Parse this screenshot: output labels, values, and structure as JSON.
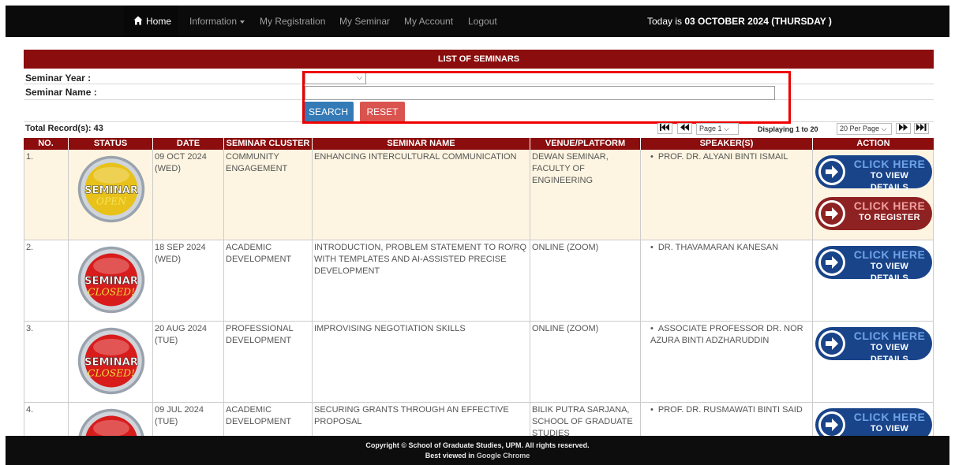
{
  "nav": {
    "home": "Home",
    "information": "Information",
    "my_registration": "My Registration",
    "my_seminar": "My Seminar",
    "my_account": "My Account",
    "logout": "Logout",
    "today_prefix": "Today is",
    "today_value": "03 OCTOBER 2024 (THURSDAY )"
  },
  "banner": "LIST OF SEMINARS",
  "filters": {
    "year_label": "Seminar Year :",
    "year_value": "",
    "name_label": "Seminar Name :",
    "name_value": "",
    "search": "SEARCH",
    "reset": "RESET"
  },
  "total_records": "Total Record(s): 43",
  "pager": {
    "first": "⏮",
    "prev": "◀◀",
    "page_select": "Page 1",
    "displaying": "Displaying 1 to 20",
    "per_page": "20 Per Page",
    "next": "▶▶",
    "last": "⏭"
  },
  "columns": [
    "NO.",
    "STATUS",
    "DATE",
    "SEMINAR CLUSTER",
    "SEMINAR NAME",
    "VENUE/PLATFORM",
    "SPEAKER(S)",
    "ACTION"
  ],
  "rows": [
    {
      "no": "1.",
      "status": "SEMINAR OPEN",
      "status_icon": "seminar-open-badge",
      "date": "09 OCT 2024 (WED)",
      "cluster": "COMMUNITY ENGAGEMENT",
      "name": "ENHANCING INTERCULTURAL COMMUNICATION",
      "venue": "DEWAN SEMINAR, FACULTY OF ENGINEERING",
      "speaker": "PROF. DR. ALYANI BINTI ISMAIL",
      "highlight": true,
      "actions": [
        {
          "line1": "CLICK HERE",
          "line2": "TO VIEW DETAILS",
          "color": "#19448a"
        },
        {
          "line1": "CLICK HERE",
          "line2": "TO REGISTER",
          "color": "#8e2222"
        }
      ]
    },
    {
      "no": "2.",
      "status": "SEMINAR CLOSED!",
      "status_icon": "seminar-closed-badge",
      "date": "18 SEP 2024 (WED)",
      "cluster": "ACADEMIC DEVELOPMENT",
      "name": "INTRODUCTION, PROBLEM STATEMENT TO RO/RQ WITH TEMPLATES AND AI-ASSISTED PRECISE DEVELOPMENT",
      "venue": "ONLINE (ZOOM)",
      "speaker": "DR. THAVAMARAN KANESAN",
      "highlight": false,
      "actions": [
        {
          "line1": "CLICK HERE",
          "line2": "TO VIEW DETAILS",
          "color": "#19448a"
        }
      ]
    },
    {
      "no": "3.",
      "status": "SEMINAR CLOSED!",
      "status_icon": "seminar-closed-badge",
      "date": "20 AUG 2024 (TUE)",
      "cluster": "PROFESSIONAL DEVELOPMENT",
      "name": "IMPROVISING NEGOTIATION SKILLS",
      "venue": "ONLINE (ZOOM)",
      "speaker": "ASSOCIATE PROFESSOR DR. NOR AZURA BINTI ADZHARUDDIN",
      "highlight": false,
      "actions": [
        {
          "line1": "CLICK HERE",
          "line2": "TO VIEW DETAILS",
          "color": "#19448a"
        }
      ]
    },
    {
      "no": "4.",
      "status": "SEMINAR CLOSED!",
      "status_icon": "seminar-closed-badge",
      "date": "09 JUL 2024 (TUE)",
      "cluster": "ACADEMIC DEVELOPMENT",
      "name": "SECURING GRANTS THROUGH AN EFFECTIVE PROPOSAL",
      "venue": "BILIK PUTRA SARJANA, SCHOOL OF GRADUATE STUDIES",
      "speaker": "PROF. DR. RUSMAWATI BINTI SAID",
      "highlight": false,
      "actions": [
        {
          "line1": "CLICK HERE",
          "line2": "TO VIEW DETAILS",
          "color": "#19448a"
        }
      ]
    }
  ],
  "footer": {
    "copyright": "Copyright © School of Graduate Studies, UPM. All rights reserved.",
    "best_prefix": "Best viewed in",
    "best_browser": "Google Chrome"
  },
  "colors": {
    "header_red": "#8b0d0d",
    "open_badge": "#e8c21a",
    "closed_badge": "#d81c1c",
    "view_button": "#19448a",
    "register_button": "#8e2222",
    "highlight_row": "#fdf5e1"
  }
}
